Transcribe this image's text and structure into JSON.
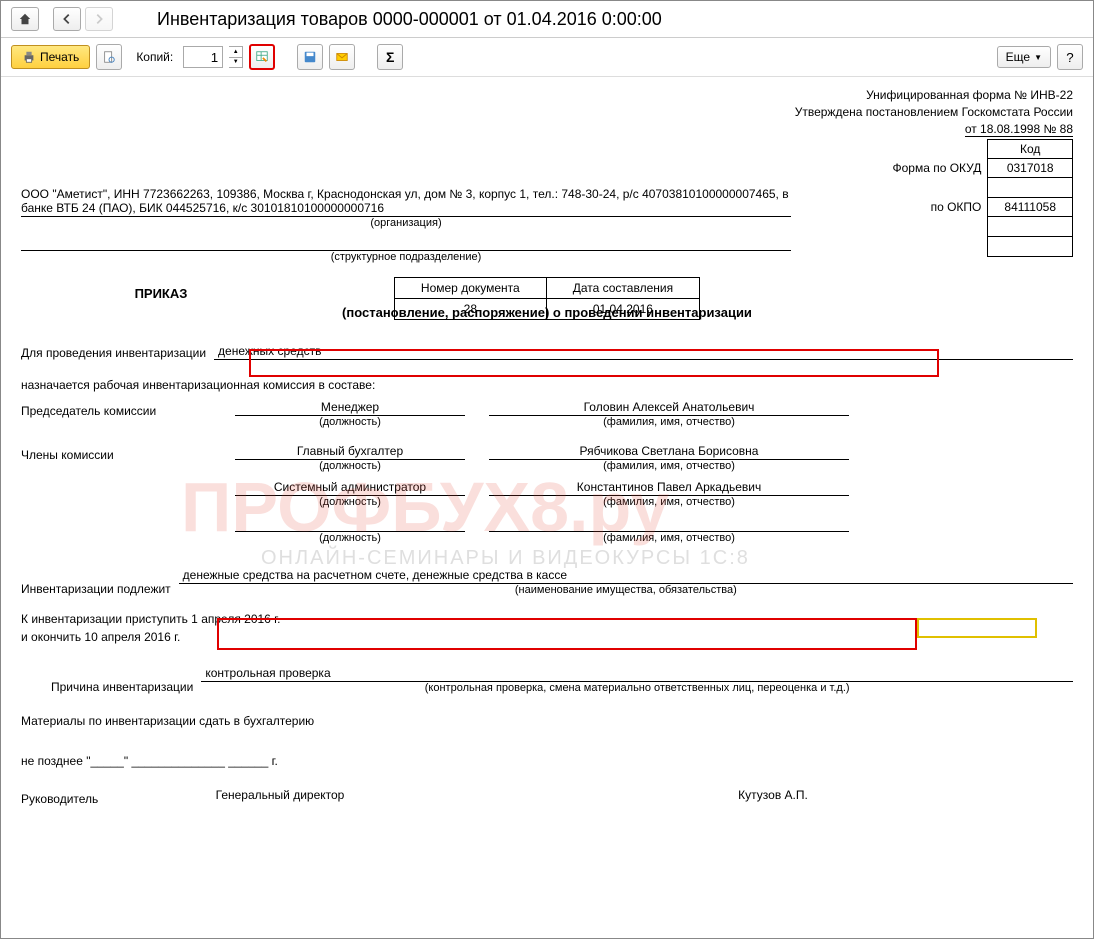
{
  "title": "Инвентаризация товаров 0000-000001 от 01.04.2016 0:00:00",
  "toolbar": {
    "print": "Печать",
    "copies_label": "Копий:",
    "copies_value": "1",
    "more": "Еще",
    "help": "?"
  },
  "header": {
    "form_title": "Унифицированная форма № ИНВ-22",
    "approved": "Утверждена постановлением Госкомстата России",
    "date_ref": "от 18.08.1998 № 88",
    "code_label": "Код",
    "okud_label": "Форма по ОКУД",
    "okud": "0317018",
    "okpo_label": "по ОКПО",
    "okpo": "84111058"
  },
  "org": {
    "text": "ООО \"Аметист\", ИНН 7723662263, 109386, Москва г, Краснодонская ул, дом № 3, корпус 1, тел.: 748-30-24, р/с 40703810100000007465, в банке ВТБ 24 (ПАО), БИК 044525716, к/с 30101810100000000716",
    "sub": "(организация)",
    "struct_sub": "(структурное подразделение)"
  },
  "doc_num": {
    "col1": "Номер документа",
    "col2": "Дата составления",
    "num": "28",
    "date": "01.04.2016"
  },
  "prikaz": "ПРИКАЗ",
  "subtitle": "(постановление, распоряжение) о проведении инвентаризации",
  "inv_for_label": "Для проведения инвентаризации",
  "inv_for_value": "денежных средств",
  "commission_text": "назначается рабочая инвентаризационная комиссия в составе:",
  "chairman_label": "Председатель комиссии",
  "members_label": "Члены комиссии",
  "role_sub": "(должность)",
  "name_sub": "(фамилия, имя, отчество)",
  "members": [
    {
      "role": "Менеджер",
      "name": "Головин Алексей Анатольевич"
    },
    {
      "role": "Главный бухгалтер",
      "name": "Рябчикова Светлана Борисовна"
    },
    {
      "role": "Системный администратор",
      "name": "Константинов Павел Аркадьевич"
    },
    {
      "role": "",
      "name": ""
    }
  ],
  "subject_label": "Инвентаризации подлежит",
  "subject_value": "денежные средства на расчетном счете, денежные средства в кассе",
  "subject_sub": "(наименование имущества, обязательства)",
  "start_text": "К инвентаризации приступить 1 апреля 2016 г.",
  "end_text": "и окончить 10 апреля 2016 г.",
  "reason_label": "Причина инвентаризации",
  "reason_value": "контрольная проверка",
  "reason_sub": "(контрольная проверка, смена материально ответственных лиц, переоценка и т.д.)",
  "materials_text": "Материалы по инвентаризации сдать в бухгалтерию",
  "deadline_label": "не позднее \"_____\" ______________ ______ г.",
  "signer_label": "Руководитель",
  "signer_role": "Генеральный директор",
  "signer_name": "Кутузов А.П.",
  "watermark": "ПРОФБУХ8.ру",
  "watermark_sub": "ОНЛАЙН-СЕМИНАРЫ И ВИДЕОКУРСЫ 1С:8"
}
